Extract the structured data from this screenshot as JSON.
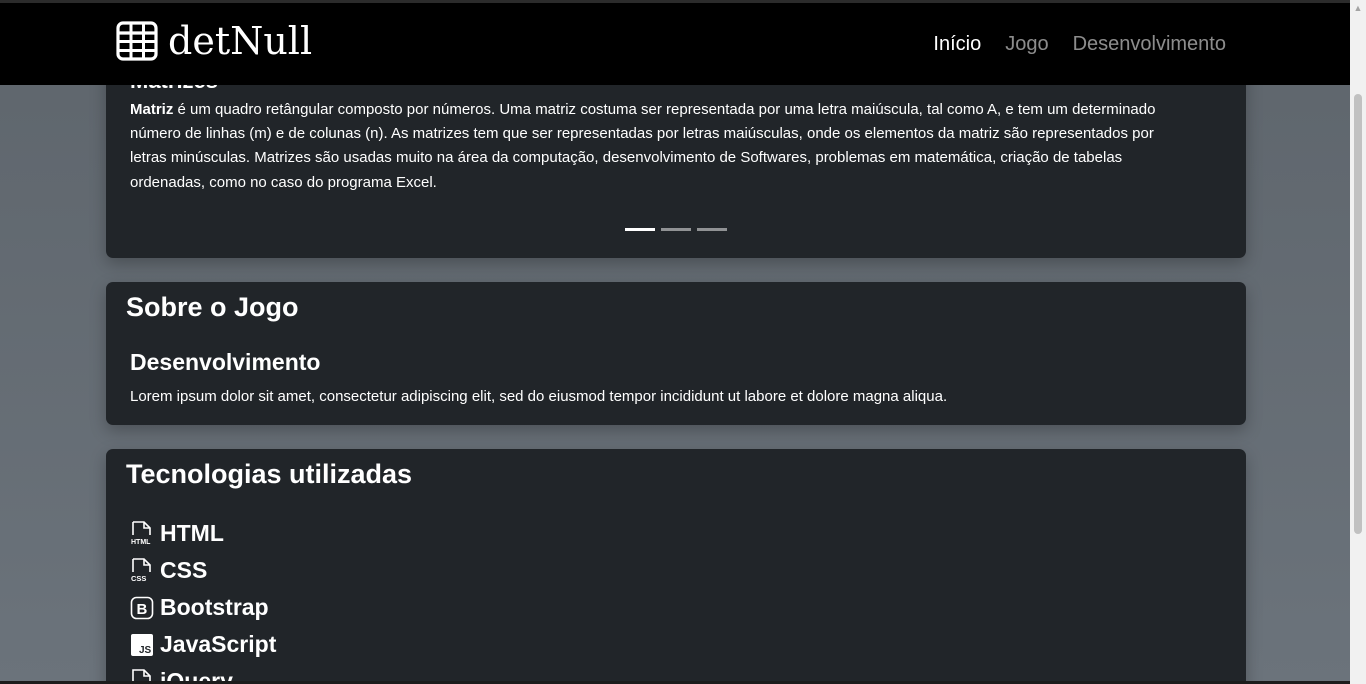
{
  "navbar": {
    "brand": "detNull",
    "links": [
      {
        "label": "Início",
        "active": true
      },
      {
        "label": "Jogo",
        "active": false
      },
      {
        "label": "Desenvolvimento",
        "active": false
      }
    ]
  },
  "carousel": {
    "partial_title": "Matrizes",
    "term": "Matriz",
    "text": " é um quadro retângular composto por números. Uma matriz costuma ser representada por uma letra maiúscula, tal como A, e tem um determinado número de linhas (m) e de colunas (n). As matrizes tem que ser representadas por letras maiúsculas, onde os elementos da matriz são representados por letras minúsculas. Matrizes são usadas muito na área da computação, desenvolvimento de Softwares, problemas em matemática, criação de tabelas ordenadas, como no caso do programa Excel.",
    "slides": 3,
    "active_slide": 1
  },
  "about": {
    "title": "Sobre o Jogo",
    "subtitle": "Desenvolvimento",
    "text": "Lorem ipsum dolor sit amet, consectetur adipiscing elit, sed do eiusmod tempor incididunt ut labore et dolore magna aliqua."
  },
  "tech": {
    "title": "Tecnologias utilizadas",
    "items": [
      {
        "label": "HTML",
        "icon": "filetype-html-icon"
      },
      {
        "label": "CSS",
        "icon": "filetype-css-icon"
      },
      {
        "label": "Bootstrap",
        "icon": "bootstrap-icon"
      },
      {
        "label": "JavaScript",
        "icon": "javascript-icon"
      },
      {
        "label": "jQuery",
        "icon": "file-icon"
      }
    ]
  },
  "colors": {
    "page_bg": "#6c757d",
    "card_bg": "#212529",
    "navbar_bg": "#000000"
  }
}
